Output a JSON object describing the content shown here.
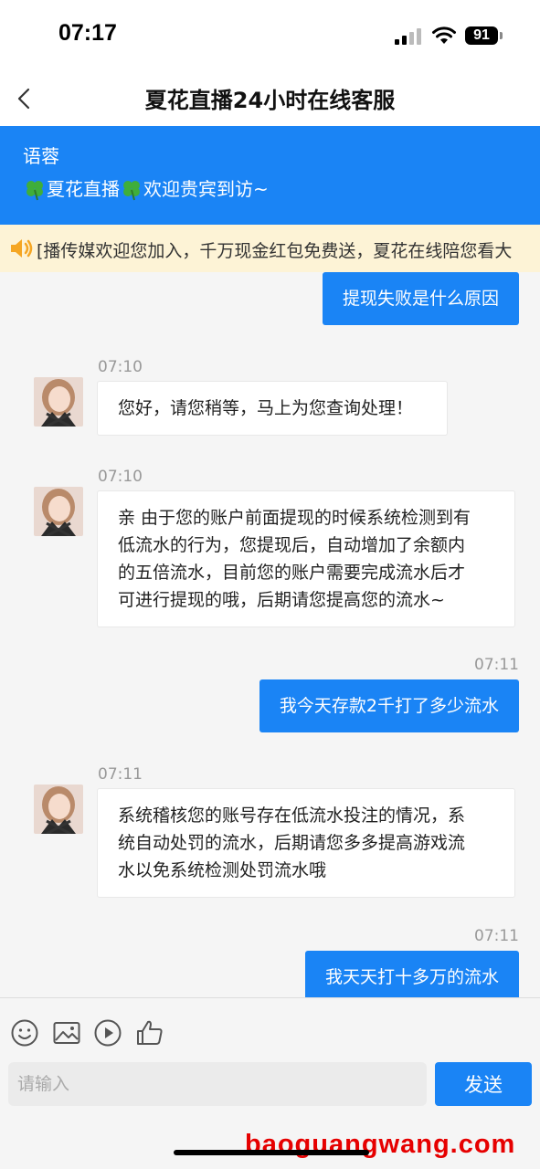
{
  "status": {
    "time": "07:17",
    "battery": "91"
  },
  "nav": {
    "title": "夏花直播24小时在线客服"
  },
  "agent": {
    "name": "语蓉",
    "greeting": "夏花直播",
    "greeting_tail": "欢迎贵宾到访~"
  },
  "notice": {
    "text": "[播传媒欢迎您加入，千万现金红包免费送，夏花在线陪您看大"
  },
  "messages": [
    {
      "from": "user",
      "text": "提现失败是什么原因"
    },
    {
      "from": "agent",
      "time": "07:10",
      "text": "您好，请您稍等，马上为您查询处理！"
    },
    {
      "from": "agent",
      "time": "07:10",
      "lines": [
        "亲 由于您的账户前面提现的时候系统检测到有",
        "低流水的行为，您提现后，自动增加了余额内",
        "的五倍流水，目前您的账户需要完成流水后才",
        "可进行提现的哦，后期请您提高您的流水~"
      ]
    },
    {
      "from": "user",
      "time": "07:11",
      "text": "我今天存款2千打了多少流水"
    },
    {
      "from": "agent",
      "time": "07:11",
      "lines": [
        "系统稽核您的账号存在低流水投注的情况，系",
        "统自动处罚的流水，后期请您多多提高游戏流",
        "水以免系统检测处罚流水哦"
      ]
    },
    {
      "from": "user",
      "time": "07:11",
      "text": "我天天打十多万的流水"
    }
  ],
  "composer": {
    "placeholder": "请输入",
    "send_label": "发送"
  },
  "watermark": "baoguangwang.com",
  "colors": {
    "primary": "#1a84f5",
    "notice_bg": "#fdf3d6",
    "watermark": "#e60000"
  },
  "icons": [
    "back-chevron-icon",
    "clover-icon",
    "speaker-icon",
    "smile-icon",
    "image-icon",
    "play-icon",
    "thumbs-up-icon"
  ]
}
